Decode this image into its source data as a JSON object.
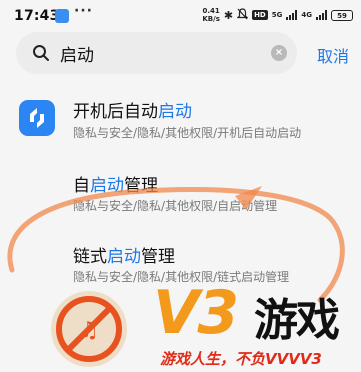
{
  "status_bar": {
    "time": "17:43",
    "more": "···",
    "net_speed_value": "0.41",
    "net_speed_unit": "KB/s",
    "hd_label": "HD",
    "net_5g": "5G",
    "net_4g": "4G",
    "battery": "59"
  },
  "search": {
    "value": "启动",
    "cancel_label": "取消"
  },
  "results": [
    {
      "title_pre": "开机后自动",
      "title_hl": "启动",
      "title_post": "",
      "path": "隐私与安全/隐私/其他权限/开机后自动启动"
    },
    {
      "title_pre": "自",
      "title_hl": "启动",
      "title_post": "管理",
      "path": "隐私与安全/隐私/其他权限/自启动管理"
    },
    {
      "title_pre": "链式",
      "title_hl": "启动",
      "title_post": "管理",
      "path": "隐私与安全/隐私/其他权限/链式启动管理"
    }
  ],
  "watermark": {
    "brand": "V3",
    "game": "游戏",
    "slogan": "游戏人生，不负VVVV3",
    "orange": "#f39a1c",
    "red": "#e02b18"
  }
}
